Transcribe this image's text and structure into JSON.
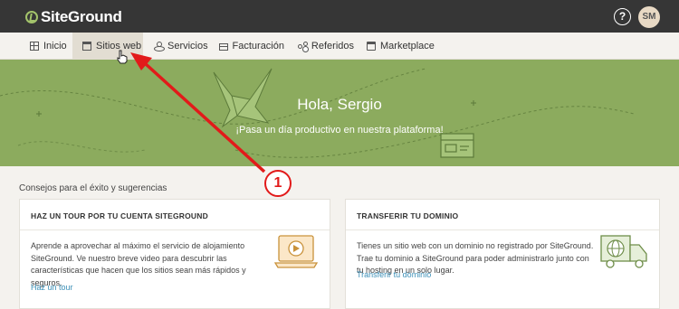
{
  "topbar": {
    "logo_text": "SiteGround",
    "help_icon": "question-circle-icon",
    "avatar_initials": "SM"
  },
  "nav": {
    "items": [
      {
        "label": "Inicio",
        "icon": "grid-icon"
      },
      {
        "label": "Sitios web",
        "icon": "website-icon",
        "active": true
      },
      {
        "label": "Servicios",
        "icon": "services-icon"
      },
      {
        "label": "Facturación",
        "icon": "billing-card-icon"
      },
      {
        "label": "Referidos",
        "icon": "share-icon"
      },
      {
        "label": "Marketplace",
        "icon": "store-icon"
      }
    ]
  },
  "hero": {
    "greeting": "Hola, Sergio",
    "subtitle": "¡Pasa un día productivo en nuestra plataforma!",
    "background_color": "#8cab5e"
  },
  "tips": {
    "section_label": "Consejos para el éxito y sugerencias",
    "cards": [
      {
        "title": "HAZ UN TOUR POR TU CUENTA SITEGROUND",
        "text_lines": [
          "Aprende a aprovechar al máximo el servicio de alojamiento",
          "SiteGround. Ve nuestro breve video para descubrir las",
          "características que hacen que los sitios sean más rápidos y",
          "seguros."
        ],
        "link": "Haz un tour",
        "icon": "video-laptop-icon"
      },
      {
        "title": "TRANSFERIR TU DOMINIO",
        "text_lines": [
          "Tienes un sitio web con un dominio no registrado por SiteGround.",
          "Trae tu dominio a SiteGround para poder administrarlo junto con",
          "tu hosting en un solo lugar."
        ],
        "link": "Transferir tu dominio",
        "icon": "globe-truck-icon"
      }
    ]
  },
  "annotation": {
    "step_number": "1",
    "color": "#e21a1a"
  },
  "colors": {
    "topbar": "#363636",
    "accent_green": "#8cab5e",
    "link_blue": "#3b8fb7"
  }
}
